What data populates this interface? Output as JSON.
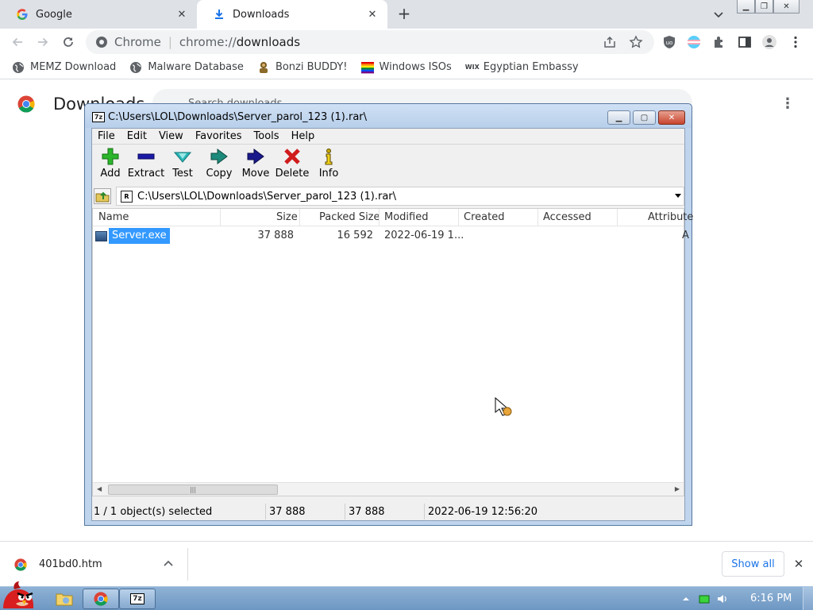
{
  "browser": {
    "tabs": [
      {
        "title": "Google",
        "icon": "google-icon"
      },
      {
        "title": "Downloads",
        "icon": "download-icon"
      }
    ],
    "omnibox": {
      "scheme_label": "Chrome",
      "separator": "|",
      "url_prefix": "chrome://",
      "url_host": "downloads"
    },
    "bookmarks": [
      {
        "label": "MEMZ Download",
        "icon": "globe-icon"
      },
      {
        "label": "Malware Database",
        "icon": "globe-icon"
      },
      {
        "label": "Bonzi BUDDY!",
        "icon": "bonzi-icon"
      },
      {
        "label": "Windows ISOs",
        "icon": "rainbow-flag-icon"
      },
      {
        "label": "Egyptian Embassy",
        "icon": "wix-icon",
        "icon_text": "WIX"
      }
    ]
  },
  "downloads_page": {
    "title": "Downloads",
    "search_placeholder": "Search downloads"
  },
  "shelf": {
    "file_name": "401bd0.htm",
    "show_all_label": "Show all"
  },
  "sevenzip": {
    "title": "C:\\Users\\LOL\\Downloads\\Server_parol_123 (1).rar\\",
    "title_icon_text": "7z",
    "menu": [
      "File",
      "Edit",
      "View",
      "Favorites",
      "Tools",
      "Help"
    ],
    "toolbar": [
      {
        "label": "Add",
        "icon": "add-icon",
        "color": "#2bb52b"
      },
      {
        "label": "Extract",
        "icon": "extract-icon",
        "color": "#1a1aa6"
      },
      {
        "label": "Test",
        "icon": "test-icon",
        "color": "#2ab8b8"
      },
      {
        "label": "Copy",
        "icon": "copy-icon",
        "color": "#1c8a7a"
      },
      {
        "label": "Move",
        "icon": "move-icon",
        "color": "#1a1a8c"
      },
      {
        "label": "Delete",
        "icon": "delete-icon",
        "color": "#d01c1c"
      },
      {
        "label": "Info",
        "icon": "info-icon",
        "color": "#c9a700"
      }
    ],
    "path": "C:\\Users\\LOL\\Downloads\\Server_parol_123 (1).rar\\",
    "path_icon_text": "R",
    "columns": [
      "Name",
      "Size",
      "Packed Size",
      "Modified",
      "Created",
      "Accessed",
      "Attribute"
    ],
    "rows": [
      {
        "name": "Server.exe",
        "size": "37 888",
        "packed": "16 592",
        "modified": "2022-06-19 1...",
        "created": "",
        "accessed": "",
        "attr": "A"
      }
    ],
    "status": {
      "selection": "1 / 1 object(s) selected",
      "size": "37 888",
      "packed": "37 888",
      "modified": "2022-06-19 12:56:20"
    }
  },
  "taskbar": {
    "clock": "6:16 PM"
  },
  "colors": {
    "chrome_frame": "#dee1e6",
    "omnibox_bg": "#f1f3f4",
    "selection": "#3399ff",
    "link_blue": "#1a73e8",
    "taskbar": "#7ea4cc"
  }
}
